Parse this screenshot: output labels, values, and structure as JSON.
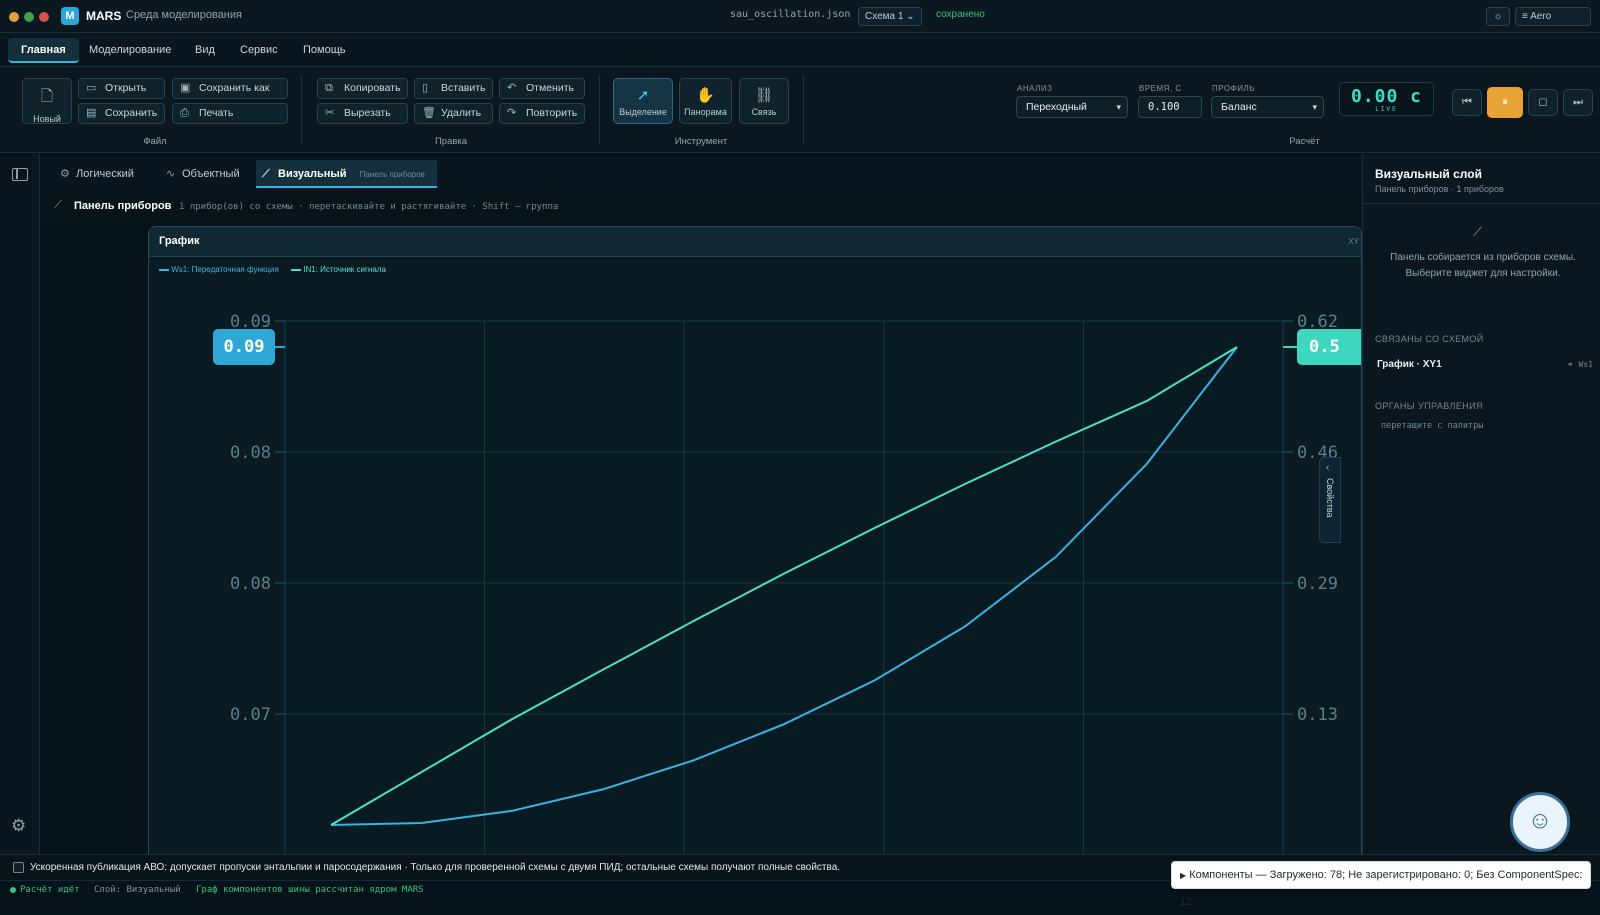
{
  "titlebar": {
    "app_name": "MARS",
    "app_subtitle": "Среда моделирования",
    "file_name": "sau_oscillation.json",
    "scheme_select": "Схема 1",
    "save_status": "сохранено",
    "theme_label": "Aero"
  },
  "menu": {
    "items": [
      "Главная",
      "Моделирование",
      "Вид",
      "Сервис",
      "Помощь"
    ]
  },
  "ribbon": {
    "file": {
      "new_label": "Новый",
      "open_label": "Открыть",
      "save_as_label": "Сохранить как",
      "save_label": "Сохранить",
      "print_label": "Печать",
      "group_label": "Файл"
    },
    "edit": {
      "copy_label": "Копировать",
      "paste_label": "Вставить",
      "undo_label": "Отменить",
      "cut_label": "Вырезать",
      "delete_label": "Удалить",
      "redo_label": "Повторить",
      "group_label": "Правка"
    },
    "tools": {
      "select_label": "Выделение",
      "pan_label": "Панорама",
      "link_label": "Связь",
      "group_label": "Инструмент"
    },
    "calc": {
      "analysis_label": "АНАЛИЗ",
      "analysis_value": "Переходный",
      "time_label": "ВРЕМЯ, С",
      "time_value": "0.100",
      "profile_label": "ПРОФИЛЬ",
      "profile_value": "Баланс",
      "group_label": "Расчёт"
    },
    "timer": {
      "value": "0.00 с",
      "live": "LIVE"
    }
  },
  "layers": {
    "tabs": [
      "Логический",
      "Объектный",
      "Визуальный"
    ],
    "active_hint": "Панель приборов"
  },
  "crumb": {
    "title": "Панель приборов",
    "hint": "1 прибор(ов) со схемы · перетаскивайте и растягивайте · Shift — группа"
  },
  "widget": {
    "title": "График",
    "corner": "XY",
    "left_badge": "0.09",
    "right_badge": "0.5",
    "side_tab": "Свойства"
  },
  "chart_data": {
    "type": "line",
    "title": "",
    "xlabel": "",
    "ylabel": "",
    "y_left_ticks": [
      "0.09",
      "0.08",
      "0.08",
      "0.07"
    ],
    "y_right_ticks": [
      "0.62",
      "0.46",
      "0.29",
      "0.13"
    ],
    "grid": true,
    "legend_position": "top-left",
    "series": [
      {
        "name": "Ws1: Передаточная функция",
        "color": "#3bb3e0",
        "points": [
          [
            0.0,
            0.0
          ],
          [
            0.1,
            0.0023
          ],
          [
            0.2,
            0.0162
          ],
          [
            0.3,
            0.0405
          ],
          [
            0.4,
            0.0735
          ],
          [
            0.5,
            0.1147
          ],
          [
            0.6,
            0.1646
          ],
          [
            0.7,
            0.2262
          ],
          [
            0.8,
            0.3052
          ],
          [
            0.9,
            0.4106
          ],
          [
            1.0,
            0.5441
          ]
        ]
      },
      {
        "name": "IN1: Источник сигнала",
        "color": "#4fe0c4",
        "points": [
          [
            0.0,
            0.0
          ],
          [
            0.1,
            0.0603
          ],
          [
            0.2,
            0.1205
          ],
          [
            0.3,
            0.1767
          ],
          [
            0.4,
            0.2321
          ],
          [
            0.5,
            0.2862
          ],
          [
            0.6,
            0.3381
          ],
          [
            0.7,
            0.3883
          ],
          [
            0.8,
            0.4364
          ],
          [
            0.9,
            0.4824
          ],
          [
            1.0,
            0.5441
          ]
        ]
      }
    ]
  },
  "right_panel": {
    "title": "Визуальный слой",
    "subtitle": "Панель приборов · 1 приборов",
    "empty_text": "Панель собирается из приборов схемы. Выберите виджет для настройки.",
    "linked_header": "СВЯЗАНЫ СО СХЕМОЙ",
    "linked_item": "График · XY1",
    "linked_ref": "Ws1",
    "controls_header": "ОРГАНЫ УПРАВЛЕНИЯ",
    "controls_hint": "перетащите с палитры"
  },
  "notice": {
    "text": "Ускоренная публикация АВО: допускает пропуски энтальпии и паросодержания · Только для проверенной схемы с двумя ПИД; остальные схемы получают полные свойства."
  },
  "toast": {
    "text": "Компоненты — Загружено: 78; Не зарегистрировано: 0; Без ComponentSpec: 12"
  },
  "status": {
    "running": "Расчёт идёт",
    "layer": "Слой: Визуальный",
    "graph": "Граф компонентов шины рассчитан ядром MARS"
  },
  "colors": {
    "accent": "#2bb5e0",
    "teal": "#39e0c8",
    "pause": "#e8a336",
    "saved": "#35c47a"
  }
}
